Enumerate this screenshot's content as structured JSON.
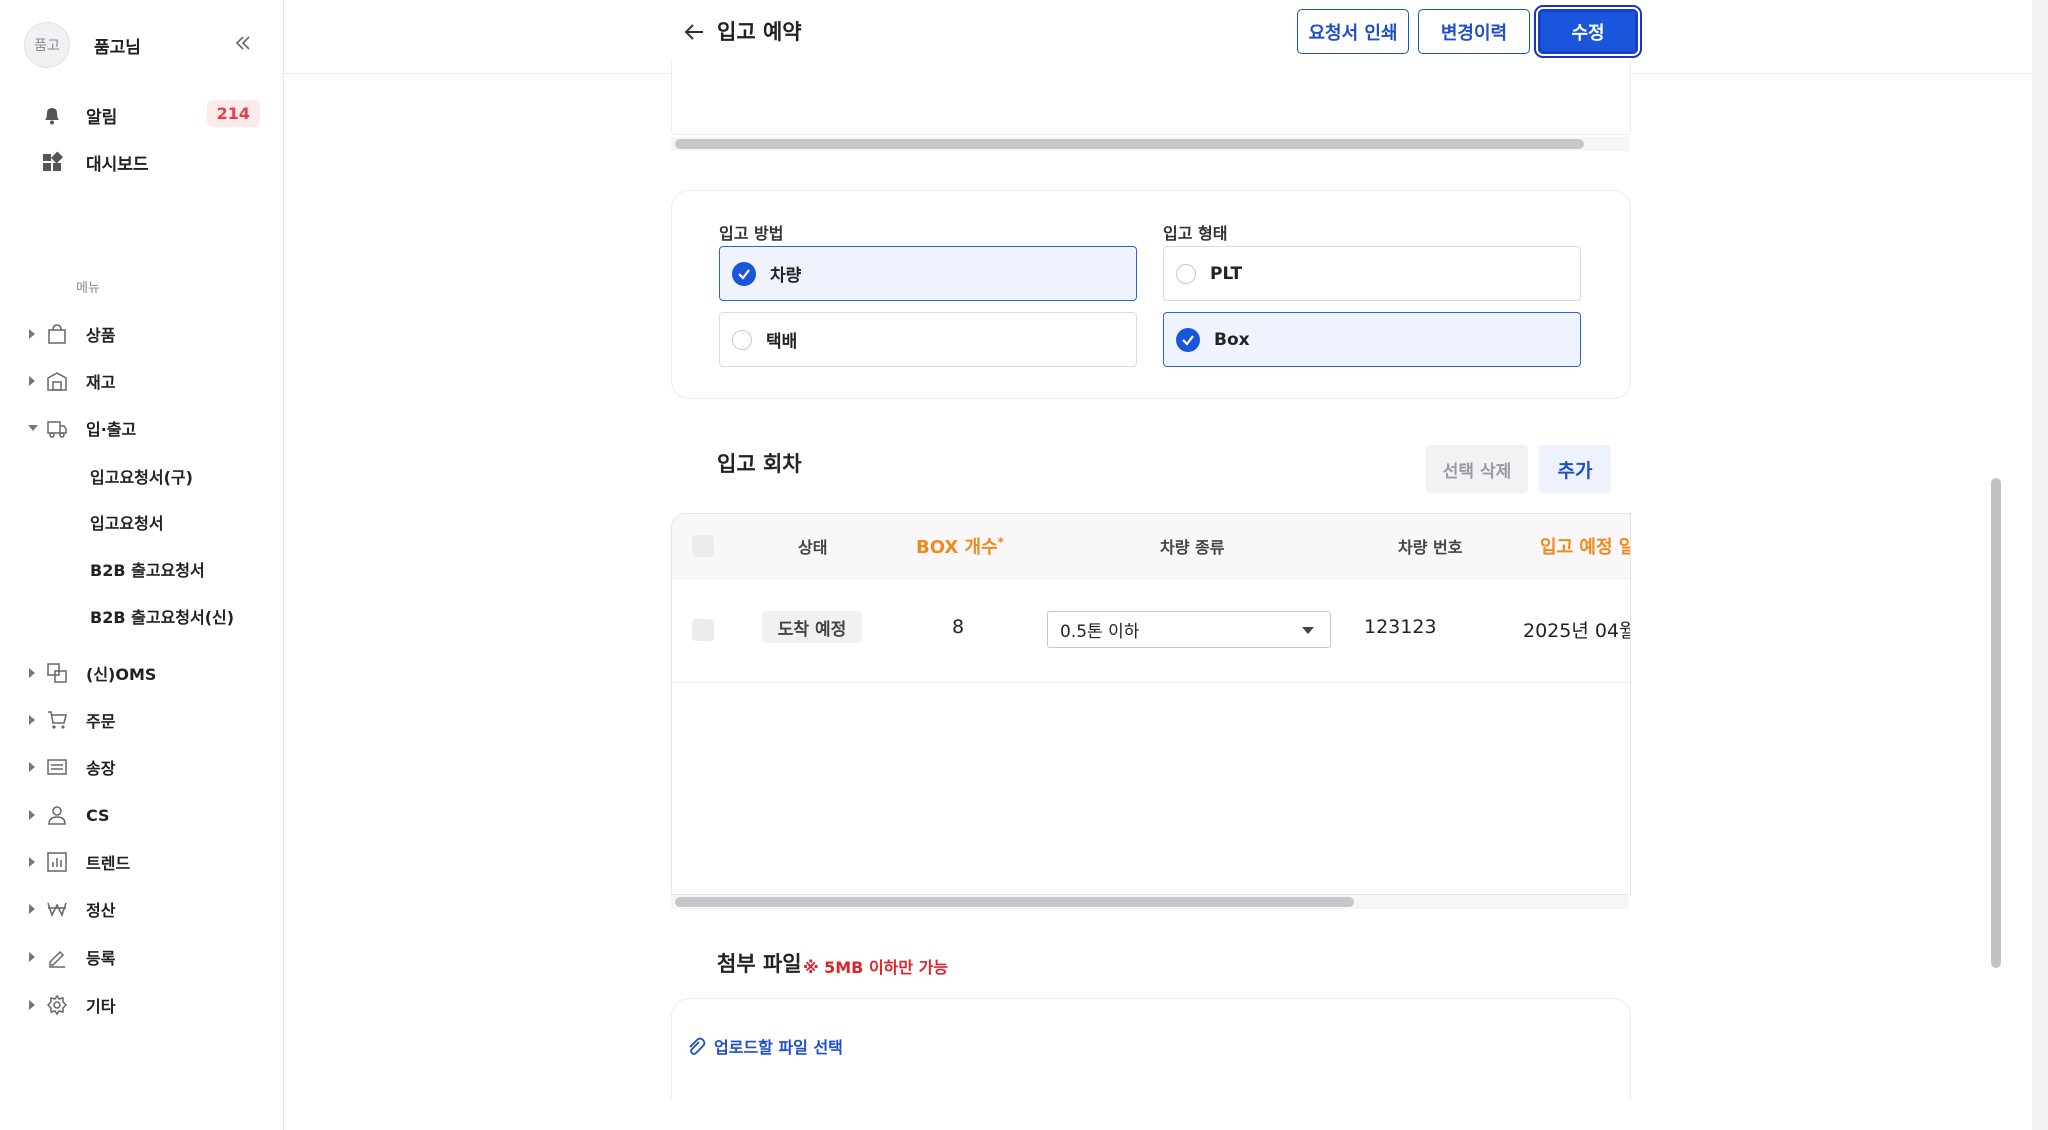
{
  "sidebar": {
    "avatar_text": "품고",
    "user_name": "품고님",
    "notifications_label": "알림",
    "notifications_count": "214",
    "dashboard_label": "대시보드",
    "menu_heading": "메뉴",
    "items": [
      {
        "label": "상품",
        "icon": "bag-icon"
      },
      {
        "label": "재고",
        "icon": "warehouse-icon"
      },
      {
        "label": "입·출고",
        "icon": "truck-icon"
      },
      {
        "label": "(신)OMS",
        "icon": "oms-icon"
      },
      {
        "label": "주문",
        "icon": "cart-icon"
      },
      {
        "label": "송장",
        "icon": "invoice-icon"
      },
      {
        "label": "CS",
        "icon": "person-icon"
      },
      {
        "label": "트렌드",
        "icon": "chart-icon"
      },
      {
        "label": "정산",
        "icon": "won-icon"
      },
      {
        "label": "등록",
        "icon": "pencil-icon"
      },
      {
        "label": "기타",
        "icon": "gear-icon"
      }
    ],
    "sub_items": [
      "입고요청서(구)",
      "입고요청서",
      "B2B 출고요청서",
      "B2B 출고요청서(신)"
    ]
  },
  "header": {
    "title": "입고 예약",
    "print_label": "요청서 인쇄",
    "history_label": "변경이력",
    "edit_label": "수정"
  },
  "inbound": {
    "method_label": "입고 방법",
    "method_options": [
      "차량",
      "택배"
    ],
    "method_selected": "차량",
    "type_label": "입고 형태",
    "type_options": [
      "PLT",
      "Box"
    ],
    "type_selected": "Box"
  },
  "rounds": {
    "title": "입고 회차",
    "delete_label": "선택 삭제",
    "add_label": "추가",
    "columns": {
      "status": "상태",
      "box_count": "BOX 개수",
      "required_mark": "*",
      "vehicle_type": "차량 종류",
      "vehicle_number": "차량 번호",
      "expected_date": "입고 예정 일"
    },
    "rows": [
      {
        "status": "도착 예정",
        "box_count": "8",
        "vehicle_type": "0.5톤 이하",
        "vehicle_number": "123123",
        "expected_date": "2025년 04월"
      }
    ]
  },
  "attachment": {
    "title": "첨부 파일",
    "note": "※ 5MB 이하만 가능",
    "upload_label": "업로드할 파일 선택"
  },
  "colors": {
    "primary": "#1a56db",
    "accent_orange": "#f08a1c",
    "badge_red": "#e0424b",
    "warning_red": "#e0232b"
  }
}
